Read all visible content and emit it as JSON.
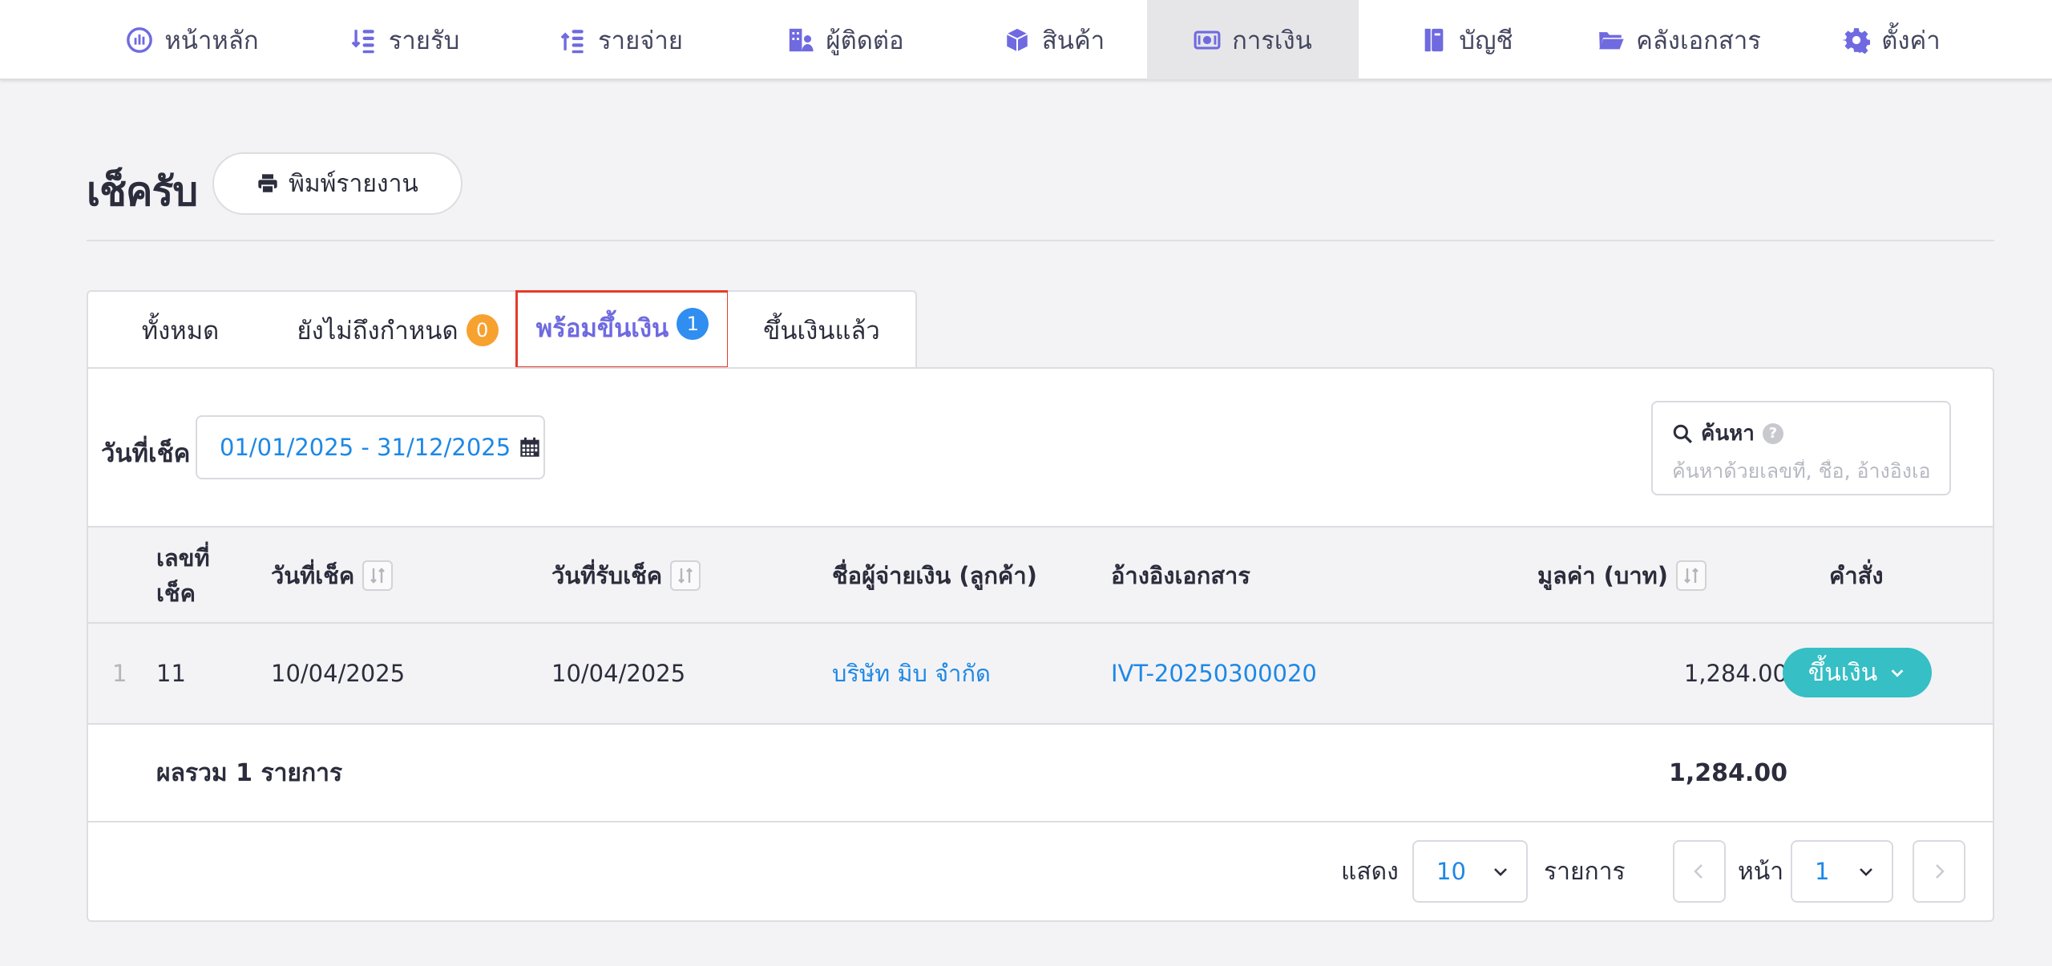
{
  "nav": {
    "items": [
      {
        "label": "หน้าหลัก",
        "icon": "dashboard-icon"
      },
      {
        "label": "รายรับ",
        "icon": "income-icon"
      },
      {
        "label": "รายจ่าย",
        "icon": "expense-icon"
      },
      {
        "label": "ผู้ติดต่อ",
        "icon": "contacts-icon"
      },
      {
        "label": "สินค้า",
        "icon": "box-icon"
      },
      {
        "label": "การเงิน",
        "icon": "money-icon"
      },
      {
        "label": "บัญชี",
        "icon": "ledger-icon"
      },
      {
        "label": "คลังเอกสาร",
        "icon": "folder-icon"
      },
      {
        "label": "ตั้งค่า",
        "icon": "gear-icon"
      }
    ],
    "active": "การเงิน"
  },
  "page": {
    "title": "เช็ครับ",
    "print_label": "พิมพ์รายงาน"
  },
  "tabs": [
    {
      "label": "ทั้งหมด"
    },
    {
      "label": "ยังไม่ถึงกำหนด",
      "badge": "0",
      "badge_color": "#f7a12f"
    },
    {
      "label": "พร้อมขึ้นเงิน",
      "badge": "1",
      "badge_color": "#2f8ef0"
    },
    {
      "label": "ขึ้นเงินแล้ว"
    }
  ],
  "filters": {
    "date_label": "วันที่เช็ค",
    "date_range": "01/01/2025 - 31/12/2025",
    "search_label": "ค้นหา",
    "search_help": "?",
    "search_placeholder": "ค้นหาด้วยเลขที่, ชื่อ, อ้างอิงเอกสาร"
  },
  "table": {
    "headers": {
      "check_no_line1": "เลขที่",
      "check_no_line2": "เช็ค",
      "check_date": "วันที่เช็ค",
      "receive_date": "วันที่รับเช็ค",
      "payer": "ชื่อผู้จ่ายเงิน (ลูกค้า)",
      "reference": "อ้างอิงเอกสาร",
      "amount": "มูลค่า (บาท)",
      "action": "คำสั่ง"
    },
    "rows": [
      {
        "index": "1",
        "check_no": "11",
        "check_date": "10/04/2025",
        "receive_date": "10/04/2025",
        "payer": "บริษัท มิบ จำกัด",
        "reference": "IVT-20250300020",
        "amount": "1,284.00",
        "action": "ขึ้นเงิน"
      }
    ],
    "footer": {
      "summary": "ผลรวม 1 รายการ",
      "total": "1,284.00"
    }
  },
  "pagination": {
    "show_label": "แสดง",
    "page_size": "10",
    "items_label": "รายการ",
    "page_label": "หน้า",
    "page": "1"
  },
  "colors": {
    "accent": "#6f6ae0",
    "link": "#1e88e5",
    "action": "#36bfc4",
    "highlight": "#e43b2c"
  }
}
